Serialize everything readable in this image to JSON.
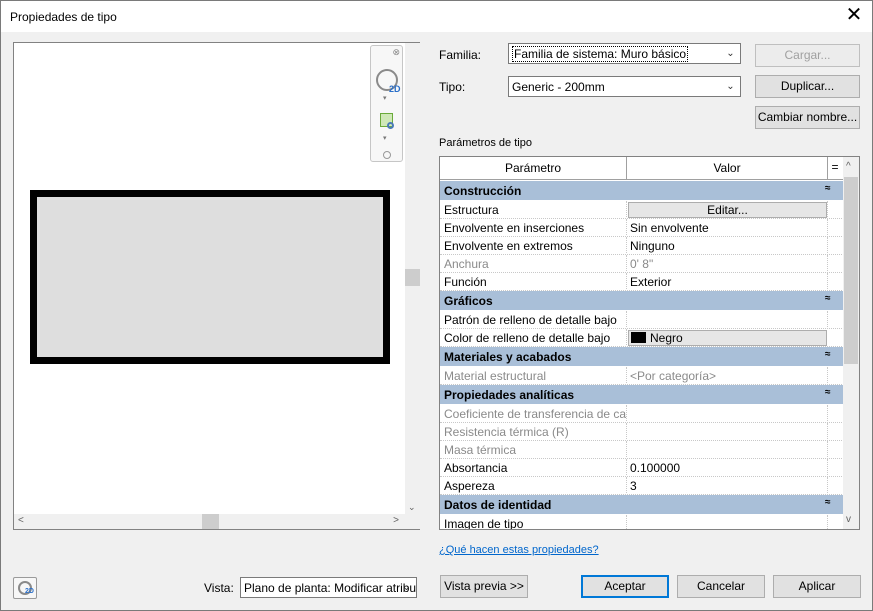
{
  "window": {
    "title": "Propiedades de tipo",
    "close_glyph": "✕"
  },
  "preview": {
    "navbar": {
      "close_glyph": "⊗",
      "wheel_label": "2D",
      "arrow_glyph": "▾"
    },
    "scroll": {
      "down": "⌄",
      "left": "<",
      "right": ">"
    }
  },
  "form": {
    "familia_label": "Familia:",
    "familia_value": "Familia de sistema: Muro básico",
    "tipo_label": "Tipo:",
    "tipo_value": "Generic - 200mm",
    "cargar": "Cargar...",
    "duplicar": "Duplicar...",
    "cambiar_nombre": "Cambiar nombre...",
    "parametros_label": "Parámetros de tipo"
  },
  "grid": {
    "col_param": "Parámetro",
    "col_valor": "Valor",
    "col_eq": "=",
    "groups": [
      {
        "title": "Construcción",
        "rows": [
          {
            "param": "Estructura",
            "value": "Editar..."
          },
          {
            "param": "Envolvente en inserciones",
            "value": "Sin envolvente"
          },
          {
            "param": "Envolvente en extremos",
            "value": "Ninguno"
          },
          {
            "param": "Anchura",
            "value": "0'  8\""
          },
          {
            "param": "Función",
            "value": "Exterior"
          }
        ]
      },
      {
        "title": "Gráficos",
        "rows": [
          {
            "param": "Patrón de relleno de detalle bajo",
            "value": ""
          },
          {
            "param": "Color de relleno de detalle bajo",
            "value": "Negro"
          }
        ]
      },
      {
        "title": "Materiales y acabados",
        "rows": [
          {
            "param": "Material estructural",
            "value": "<Por categoría>"
          }
        ]
      },
      {
        "title": "Propiedades analíticas",
        "rows": [
          {
            "param": "Coeficiente de transferencia de cal",
            "value": ""
          },
          {
            "param": "Resistencia térmica (R)",
            "value": ""
          },
          {
            "param": "Masa térmica",
            "value": ""
          },
          {
            "param": "Absortancia",
            "value": "0.100000"
          },
          {
            "param": "Aspereza",
            "value": "3"
          }
        ]
      },
      {
        "title": "Datos de identidad",
        "rows": [
          {
            "param": "Imagen de tipo",
            "value": ""
          }
        ]
      }
    ],
    "collapse_glyph": "≈",
    "scroll_up": "^",
    "scroll_down": "v",
    "color_swatch": "#000000"
  },
  "help_link": "¿Qué hacen estas propiedades?",
  "footer": {
    "vista_label": "Vista:",
    "vista_value": "Plano de planta: Modificar atribu",
    "vista_previa": "Vista previa >>",
    "aceptar": "Aceptar",
    "cancelar": "Cancelar",
    "aplicar": "Aplicar"
  },
  "colors": {
    "group_header": "#a9bfd8",
    "link": "#0066cc",
    "default_button_border": "#0078d7"
  }
}
